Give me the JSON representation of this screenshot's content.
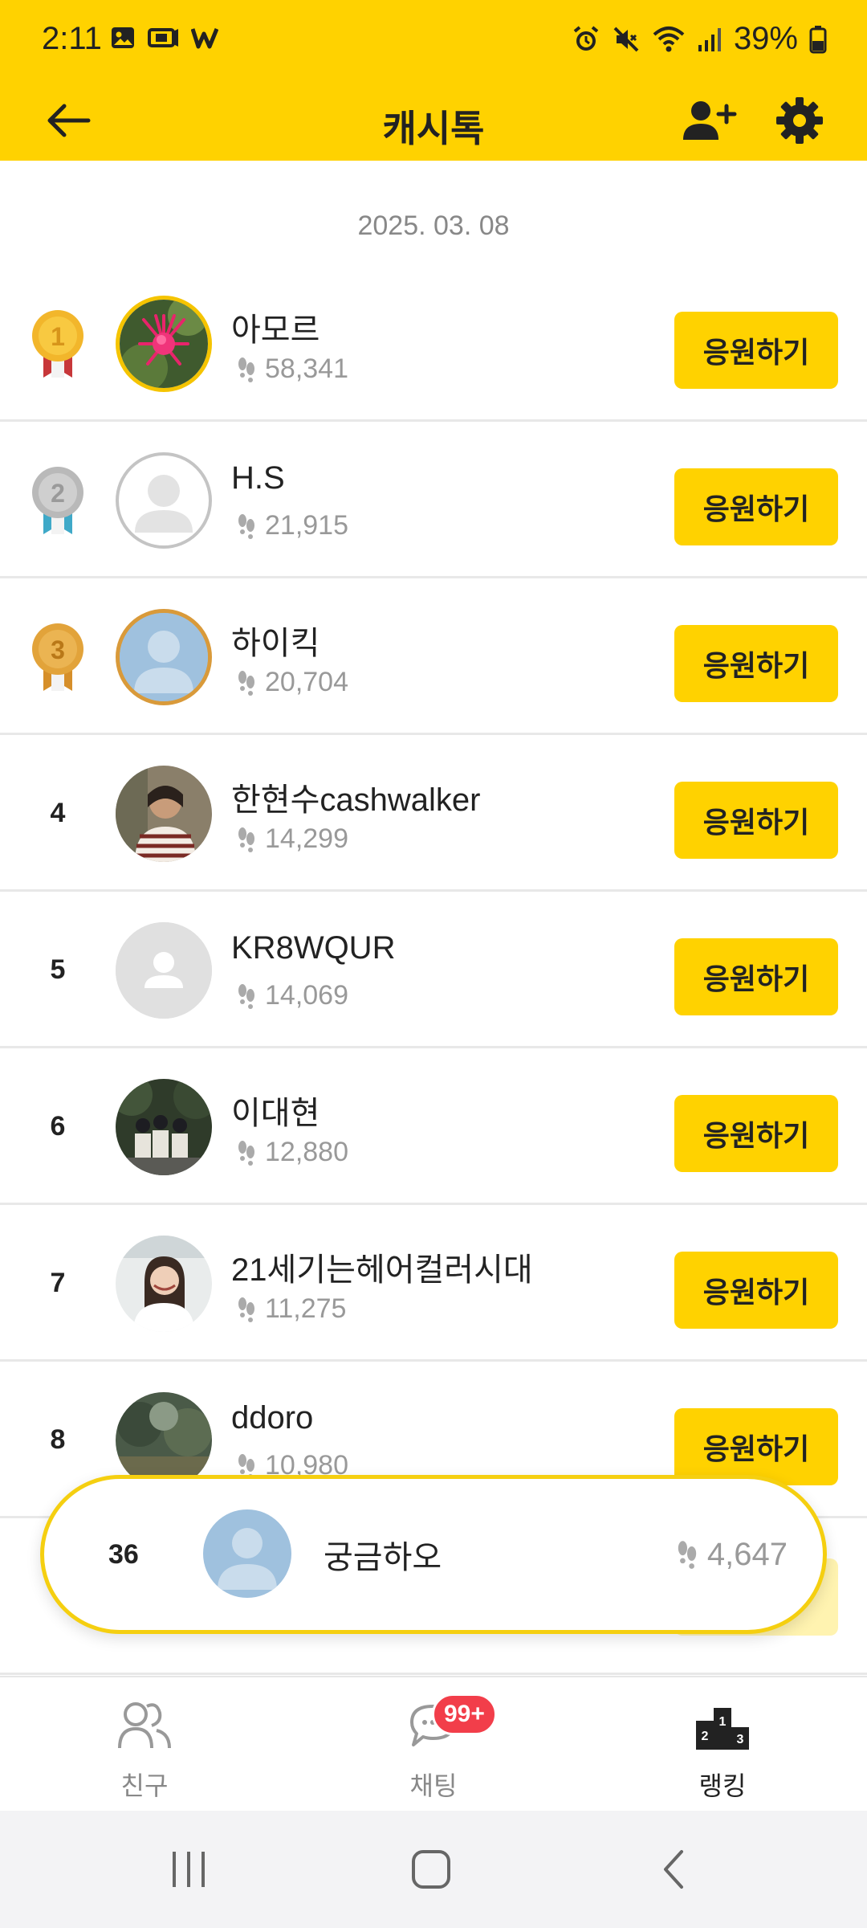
{
  "status_bar": {
    "time": "2:11",
    "battery_percent": "39%",
    "left_icons": [
      "gallery-icon",
      "ticket-icon",
      "w-app-icon"
    ],
    "right_icons": [
      "alarm-icon",
      "mute-icon",
      "wifi-icon",
      "signal-icon",
      "battery-icon"
    ]
  },
  "app_bar": {
    "title": "캐시톡",
    "back_icon": "back-arrow-icon",
    "add_friend_icon": "add-friend-icon",
    "settings_icon": "gear-icon"
  },
  "date": "2025. 03. 08",
  "cheer_label": "응원하기",
  "colors": {
    "brand_yellow": "#FFD200",
    "badge_red": "#F23E4A",
    "gold": "#F2B62B",
    "silver": "#B9B9B9",
    "bronze": "#D68F2A"
  },
  "ranking": [
    {
      "rank": "1",
      "medal": "gold",
      "name": "아모르",
      "steps": "58,341",
      "avatar": "flower-photo"
    },
    {
      "rank": "2",
      "medal": "silver",
      "name": "H.S",
      "steps": "21,915",
      "avatar": "default-avatar"
    },
    {
      "rank": "3",
      "medal": "bronze",
      "name": "하이킥",
      "steps": "20,704",
      "avatar": "default-avatar-blue"
    },
    {
      "rank": "4",
      "medal": "",
      "name": "한현수cashwalker",
      "steps": "14,299",
      "avatar": "person-photo"
    },
    {
      "rank": "5",
      "medal": "",
      "name": "KR8WQUR",
      "steps": "14,069",
      "avatar": "default-avatar-gray"
    },
    {
      "rank": "6",
      "medal": "",
      "name": "이대현",
      "steps": "12,880",
      "avatar": "group-photo"
    },
    {
      "rank": "7",
      "medal": "",
      "name": "21세기는헤어컬러시대",
      "steps": "11,275",
      "avatar": "woman-photo"
    },
    {
      "rank": "8",
      "medal": "",
      "name": "ddoro",
      "steps": "10,980",
      "avatar": "landscape-photo"
    }
  ],
  "my_rank": {
    "rank": "36",
    "name": "궁금하오",
    "steps": "4,647"
  },
  "bottom_nav": {
    "friends": "친구",
    "chat": "채팅",
    "chat_badge": "99+",
    "ranking": "랭킹"
  }
}
